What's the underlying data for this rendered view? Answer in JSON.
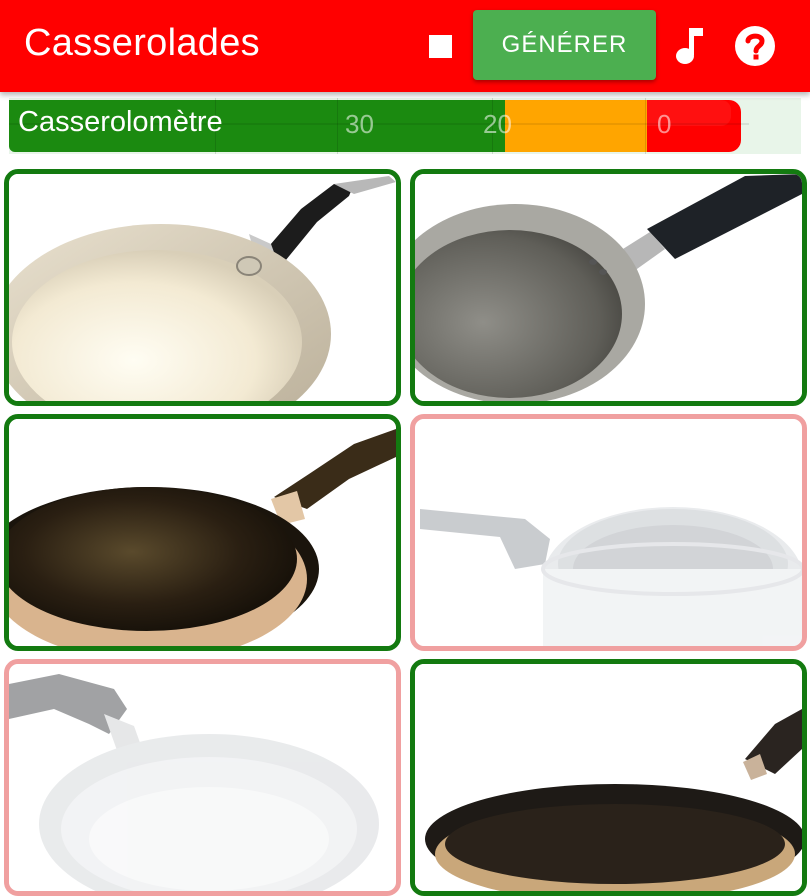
{
  "app": {
    "title": "Casserolades",
    "generate_label": "GÉNÉRER",
    "stop_icon": "stop-icon",
    "music_icon": "music-note-icon",
    "help_icon": "help-circle-icon",
    "colors": {
      "appbar": "#ff0000",
      "button": "#4caf50",
      "accepted_border": "#137a10",
      "rejected_border": "#f0a0a0"
    }
  },
  "meter": {
    "label": "Casserolomètre",
    "ticks": [
      "30",
      "20",
      "0"
    ],
    "levels": [
      {
        "name": "green",
        "color": "#1b8a10"
      },
      {
        "name": "orange",
        "color": "#ffa500"
      },
      {
        "name": "red",
        "color": "#ff0000"
      }
    ]
  },
  "cards": [
    {
      "state": "accepted",
      "pan": "cream-pan"
    },
    {
      "state": "accepted",
      "pan": "grey-pan"
    },
    {
      "state": "accepted",
      "pan": "dark-pan"
    },
    {
      "state": "rejected",
      "pan": "silver-pan"
    },
    {
      "state": "rejected",
      "pan": "silver-pan"
    },
    {
      "state": "accepted",
      "pan": "dark-pan"
    }
  ]
}
